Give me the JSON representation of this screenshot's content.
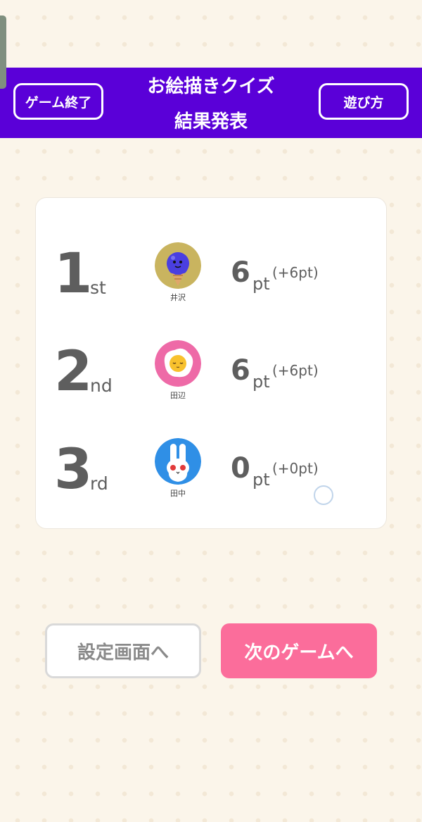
{
  "header": {
    "title_line1": "お絵描きクイズ",
    "title_line2": "結果発表",
    "end_game_label": "ゲーム終了",
    "how_to_play_label": "遊び方",
    "bg_color": "#5a00d8"
  },
  "results": [
    {
      "rank": "1",
      "suffix": "st",
      "name": "井沢",
      "points": "6",
      "unit": "pt",
      "gain": "(+6pt)",
      "avatar": "ice-cream-character-icon"
    },
    {
      "rank": "2",
      "suffix": "nd",
      "name": "田辺",
      "points": "6",
      "unit": "pt",
      "gain": "(+6pt)",
      "avatar": "fried-egg-character-icon"
    },
    {
      "rank": "3",
      "suffix": "rd",
      "name": "田中",
      "points": "0",
      "unit": "pt",
      "gain": "(+0pt)",
      "avatar": "rabbit-character-icon"
    }
  ],
  "buttons": {
    "settings_label": "設定画面へ",
    "next_game_label": "次のゲームへ",
    "next_color": "#fb6d9b"
  }
}
